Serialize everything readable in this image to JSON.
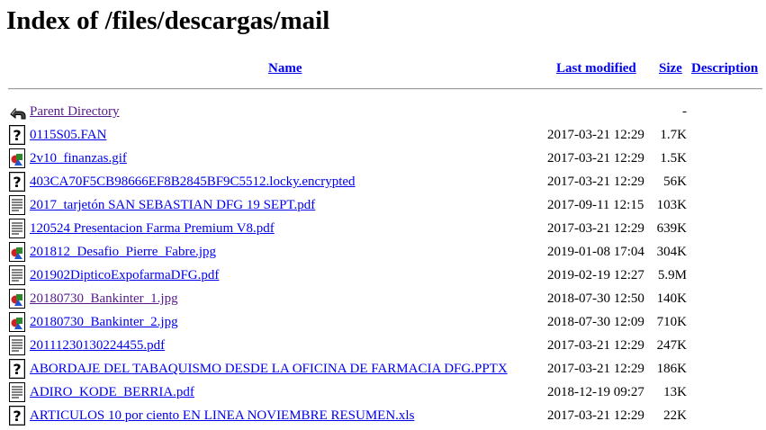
{
  "page": {
    "title": "Index of /files/descargas/mail"
  },
  "table": {
    "headers": {
      "name": "Name",
      "last_modified": "Last modified",
      "size": "Size",
      "description": "Description"
    },
    "rows": [
      {
        "icon": "back-icon",
        "name": "Parent Directory",
        "modified": "",
        "size": "-",
        "visited": true
      },
      {
        "icon": "unknown-file-icon",
        "name": "0115S05.FAN",
        "modified": "2017-03-21 12:29",
        "size": "1.7K",
        "visited": false
      },
      {
        "icon": "image-file-icon",
        "name": "2v10_finanzas.gif",
        "modified": "2017-03-21 12:29",
        "size": "1.5K",
        "visited": false
      },
      {
        "icon": "unknown-file-icon",
        "name": "403CA70F5CB98666EF8B2845BF9C5512.locky.encrypted",
        "modified": "2017-03-21 12:29",
        "size": "56K",
        "visited": false
      },
      {
        "icon": "text-file-icon",
        "name": "2017_tarjetón SAN SEBASTIAN DFG 19 SEPT.pdf",
        "modified": "2017-09-11 12:15",
        "size": "103K",
        "visited": false
      },
      {
        "icon": "text-file-icon",
        "name": "120524 Presentacion Farma Premium V8.pdf",
        "modified": "2017-03-21 12:29",
        "size": "639K",
        "visited": false
      },
      {
        "icon": "image-file-icon",
        "name": "201812_Desafio_Pierre_Fabre.jpg",
        "modified": "2019-01-08 17:04",
        "size": "304K",
        "visited": false
      },
      {
        "icon": "text-file-icon",
        "name": "201902DipticoExpofarmaDFG.pdf",
        "modified": "2019-02-19 12:27",
        "size": "5.9M",
        "visited": false
      },
      {
        "icon": "image-file-icon",
        "name": "20180730_Bankinter_1.jpg",
        "modified": "2018-07-30 12:50",
        "size": "140K",
        "visited": true
      },
      {
        "icon": "image-file-icon",
        "name": "20180730_Bankinter_2.jpg",
        "modified": "2018-07-30 12:09",
        "size": "710K",
        "visited": false
      },
      {
        "icon": "text-file-icon",
        "name": "20111230130224455.pdf",
        "modified": "2017-03-21 12:29",
        "size": "247K",
        "visited": false
      },
      {
        "icon": "unknown-file-icon",
        "name": "ABORDAJE DEL TABAQUISMO DESDE LA OFICINA DE FARMACIA DFG.PPTX",
        "modified": "2017-03-21 12:29",
        "size": "186K",
        "visited": false
      },
      {
        "icon": "text-file-icon",
        "name": "ADIRO_KODE_BERRIA.pdf",
        "modified": "2018-12-19 09:27",
        "size": "13K",
        "visited": false
      },
      {
        "icon": "unknown-file-icon",
        "name": "ARTICULOS 10 por ciento EN LINEA NOVIEMBRE RESUMEN.xls",
        "modified": "2017-03-21 12:29",
        "size": "22K",
        "visited": false
      }
    ]
  },
  "colors": {
    "link": "#0000ee",
    "visited_link": "#551a8b",
    "rule": "#9a9a9a"
  }
}
